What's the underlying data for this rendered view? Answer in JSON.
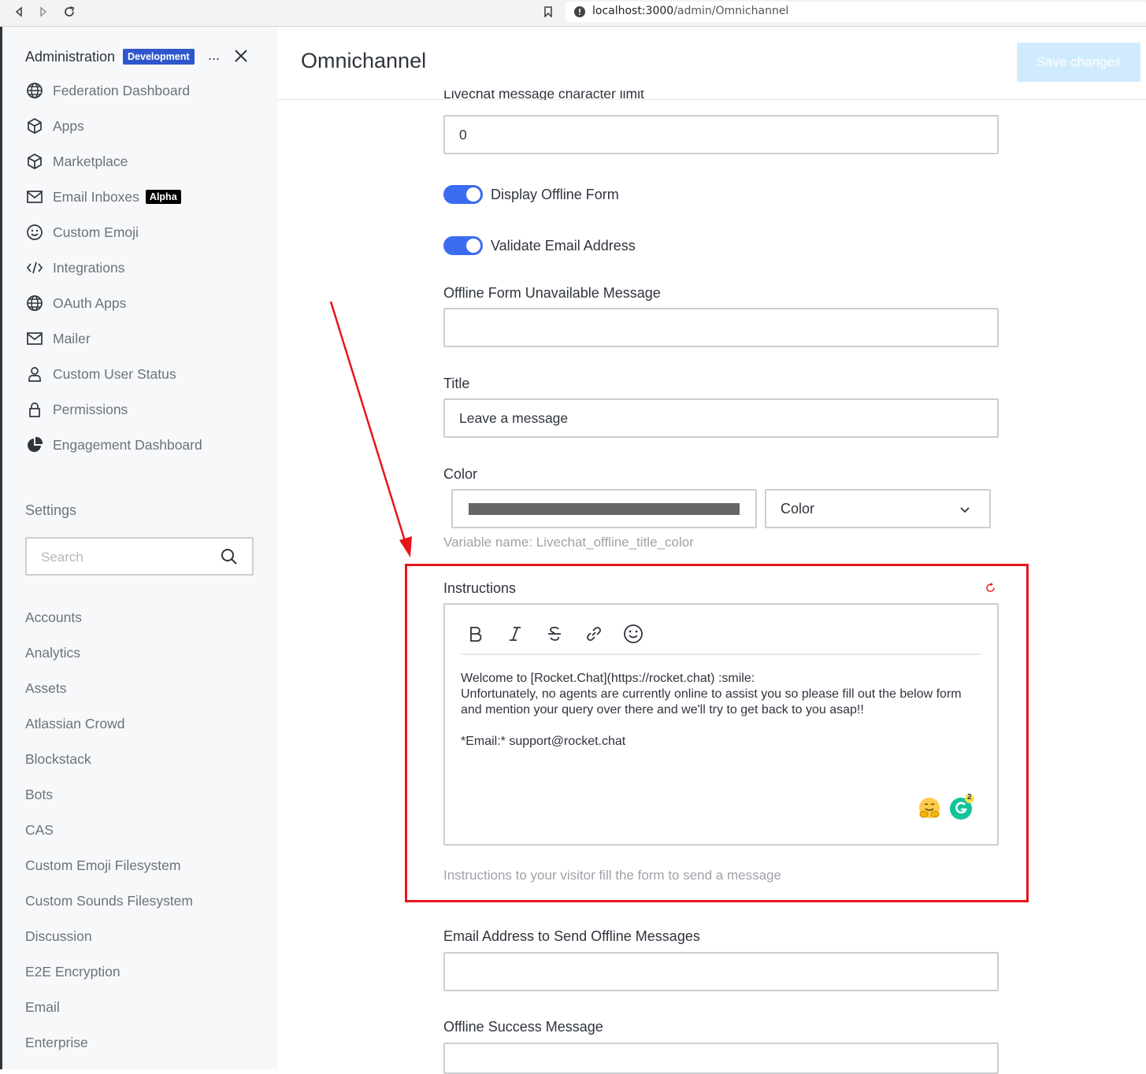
{
  "browser": {
    "url_host": "localhost:3000",
    "url_path": "/admin/Omnichannel"
  },
  "sidebar": {
    "title": "Administration",
    "env_badge": "Development",
    "more": "...",
    "items": [
      {
        "label": "Federation Dashboard",
        "icon": "globe-icon"
      },
      {
        "label": "Apps",
        "icon": "cube-icon"
      },
      {
        "label": "Marketplace",
        "icon": "cube-icon"
      },
      {
        "label": "Email Inboxes",
        "icon": "mail-icon",
        "badge": "Alpha"
      },
      {
        "label": "Custom Emoji",
        "icon": "emoji-icon"
      },
      {
        "label": "Integrations",
        "icon": "code-icon"
      },
      {
        "label": "OAuth Apps",
        "icon": "globe-icon"
      },
      {
        "label": "Mailer",
        "icon": "mail-icon"
      },
      {
        "label": "Custom User Status",
        "icon": "user-icon"
      },
      {
        "label": "Permissions",
        "icon": "lock-icon"
      },
      {
        "label": "Engagement Dashboard",
        "icon": "pie-chart-icon"
      }
    ],
    "settings_label": "Settings",
    "search_placeholder": "Search",
    "settings_items": [
      "Accounts",
      "Analytics",
      "Assets",
      "Atlassian Crowd",
      "Blockstack",
      "Bots",
      "CAS",
      "Custom Emoji Filesystem",
      "Custom Sounds Filesystem",
      "Discussion",
      "E2E Encryption",
      "Email",
      "Enterprise"
    ]
  },
  "header": {
    "title": "Omnichannel",
    "save_label": "Save changes"
  },
  "form": {
    "char_limit_label": "Livechat message character limit",
    "char_limit_value": "0",
    "display_offline_form": {
      "label": "Display Offline Form",
      "on": true
    },
    "validate_email": {
      "label": "Validate Email Address",
      "on": true
    },
    "offline_unavailable_label": "Offline Form Unavailable Message",
    "offline_unavailable_value": "",
    "title_label": "Title",
    "title_value": "Leave a message",
    "color_label": "Color",
    "color_value": "#666666",
    "color_select": "Color",
    "color_hint": "Variable name: Livechat_offline_title_color",
    "instructions_label": "Instructions",
    "instructions_text": "Welcome to [Rocket.Chat](https://rocket.chat) :smile:\nUnfortunately, no agents are currently online to assist you so please fill out the below form and mention your query over there and we'll try to get back to you asap!!\n\n*Email:* support@rocket.chat",
    "instructions_hint": "Instructions to your visitor fill the form to send a message",
    "grammarly_count": "2",
    "email_label": "Email Address to Send Offline Messages",
    "email_value": "",
    "success_label": "Offline Success Message"
  },
  "annotation_color": "#e8141b"
}
